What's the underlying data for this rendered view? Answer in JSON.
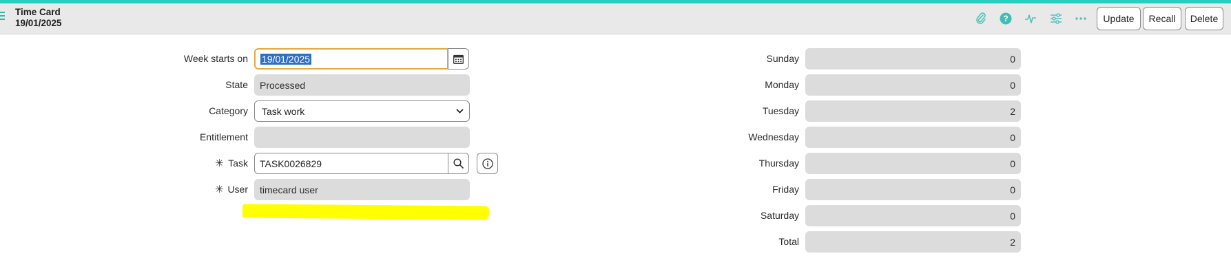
{
  "header": {
    "title": "Time Card",
    "subtitle": "19/01/2025",
    "icons": [
      "paperclip-icon",
      "help-icon",
      "activity-icon",
      "sliders-icon",
      "more-icon"
    ],
    "buttons": {
      "update": "Update",
      "recall": "Recall",
      "delete": "Delete"
    }
  },
  "form": {
    "week_starts_on": {
      "label": "Week starts on",
      "value": "19/01/2025"
    },
    "state": {
      "label": "State",
      "value": "Processed"
    },
    "category": {
      "label": "Category",
      "value": "Task work"
    },
    "entitlement": {
      "label": "Entitlement",
      "value": ""
    },
    "task": {
      "label": "Task",
      "value": "TASK0026829",
      "required_mark": "✳"
    },
    "user": {
      "label": "User",
      "value": "timecard user",
      "required_mark": "✳"
    }
  },
  "days": [
    {
      "label": "Sunday",
      "value": "0"
    },
    {
      "label": "Monday",
      "value": "0"
    },
    {
      "label": "Tuesday",
      "value": "2"
    },
    {
      "label": "Wednesday",
      "value": "0"
    },
    {
      "label": "Thursday",
      "value": "0"
    },
    {
      "label": "Friday",
      "value": "0"
    },
    {
      "label": "Saturday",
      "value": "0"
    },
    {
      "label": "Total",
      "value": "2"
    }
  ],
  "colors": {
    "accent": "#28cfc1",
    "focus": "#e8a640",
    "selection": "#2f6fc2",
    "annotation": "#ffff00"
  }
}
